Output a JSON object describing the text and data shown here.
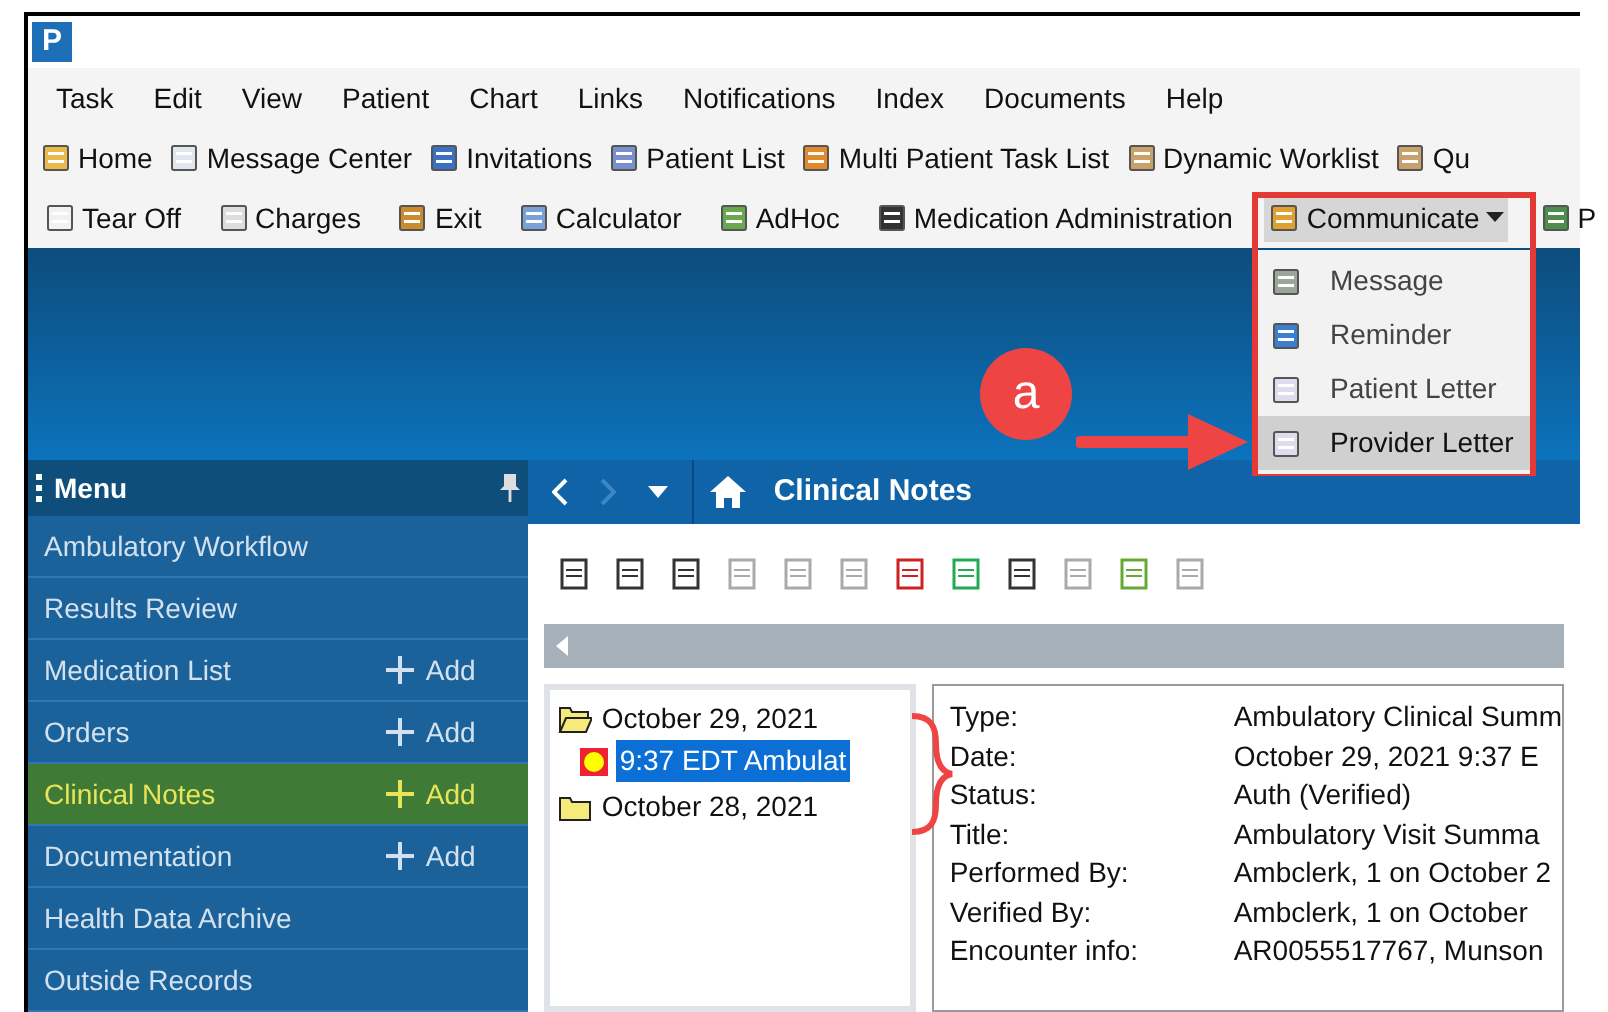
{
  "app_icon_letter": "P",
  "menu_bar": [
    "Task",
    "Edit",
    "View",
    "Patient",
    "Chart",
    "Links",
    "Notifications",
    "Index",
    "Documents",
    "Help"
  ],
  "toolbar_1": [
    {
      "label": "Home"
    },
    {
      "label": "Message Center"
    },
    {
      "label": "Invitations"
    },
    {
      "label": "Patient List"
    },
    {
      "label": "Multi Patient Task List"
    },
    {
      "label": "Dynamic Worklist"
    },
    {
      "label": "Qu"
    }
  ],
  "toolbar_2": [
    {
      "label": "Tear Off",
      "kind": "button"
    },
    {
      "label": "Charges",
      "kind": "button"
    },
    {
      "label": "Exit",
      "kind": "button"
    },
    {
      "label": "Calculator",
      "kind": "button"
    },
    {
      "label": "AdHoc",
      "kind": "button"
    },
    {
      "label": "Medication Administration",
      "kind": "button"
    },
    {
      "label": "Communicate",
      "kind": "dropdown",
      "expanded": true
    },
    {
      "label": "P",
      "kind": "button"
    }
  ],
  "communicate_menu": [
    {
      "label": "Message",
      "selected": false
    },
    {
      "label": "Reminder",
      "selected": false
    },
    {
      "label": "Patient Letter",
      "selected": false
    },
    {
      "label": "Provider Letter",
      "selected": true
    }
  ],
  "annotation": {
    "label": "a"
  },
  "sidebar": {
    "title": "Menu",
    "items": [
      {
        "label": "Ambulatory Workflow",
        "selected": false
      },
      {
        "label": "Results Review",
        "selected": false
      },
      {
        "label": "Medication List",
        "action": "Add",
        "selected": false
      },
      {
        "label": "Orders",
        "action": "Add",
        "selected": false
      },
      {
        "label": "Clinical Notes",
        "action": "Add",
        "selected": true
      },
      {
        "label": "Documentation",
        "action": "Add",
        "selected": false
      },
      {
        "label": "Health Data Archive",
        "selected": false
      },
      {
        "label": "Outside Records",
        "selected": false
      }
    ]
  },
  "nav": {
    "title": "Clinical Notes"
  },
  "tree": [
    {
      "label": "October 29, 2021",
      "expanded": true,
      "children": [
        {
          "label": "9:37 EDT Ambulat",
          "selected": true
        }
      ]
    },
    {
      "label": "October 28, 2021",
      "expanded": false
    }
  ],
  "details": [
    {
      "label": "Type:",
      "value": "Ambulatory Clinical Summ"
    },
    {
      "label": "Date:",
      "value": "October 29, 2021 9:37 E"
    },
    {
      "label": "Status:",
      "value": "Auth (Verified)"
    },
    {
      "label": "Title:",
      "value": "Ambulatory Visit Summa"
    },
    {
      "label": "Performed By:",
      "value": "Ambclerk, 1 on October 2"
    },
    {
      "label": "Verified By:",
      "value": "Ambclerk, 1 on October"
    },
    {
      "label": "Encounter info:",
      "value": "AR0055517767, Munson"
    }
  ]
}
